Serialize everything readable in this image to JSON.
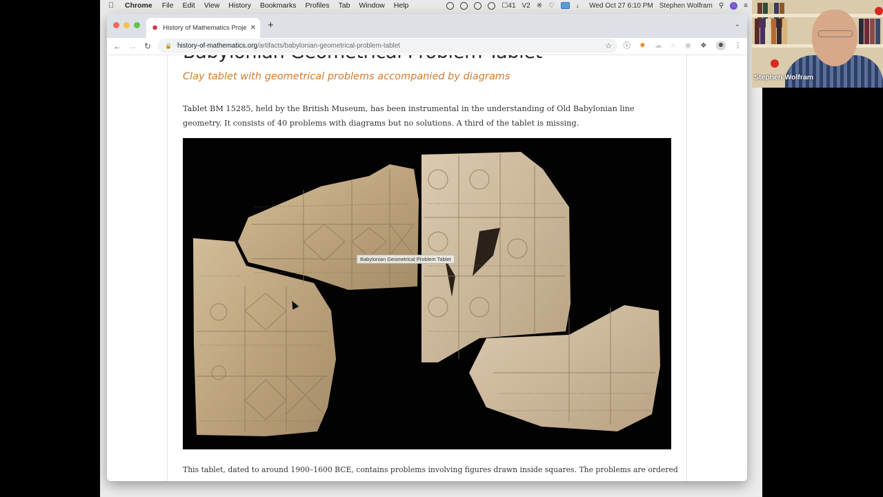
{
  "menubar": {
    "apple_icon": "apple-logo-icon",
    "app_name": "Chrome",
    "items": [
      "File",
      "Edit",
      "View",
      "History",
      "Bookmarks",
      "Profiles",
      "Tab",
      "Window",
      "Help"
    ],
    "status": {
      "battery_badge_count": "41",
      "datetime": "Wed Oct 27  6:10 PM",
      "user": "Stephen Wolfram"
    }
  },
  "browser": {
    "tab": {
      "title": "History of Mathematics Projec",
      "favicon": "gear-favicon-icon",
      "close_glyph": "✕"
    },
    "new_tab_glyph": "+",
    "tab_menu_glyph": "⌄",
    "address": {
      "host": "history-of-mathematics.org",
      "path": "/artifacts/babylonian-geometrical-problem-tablet"
    },
    "nav": {
      "back": "←",
      "forward": "→",
      "reload": "↻"
    }
  },
  "page": {
    "title": "Babylonian Geometrical Problem Tablet",
    "subtitle": "Clay tablet with geometrical problems accompanied by diagrams",
    "intro": "Tablet BM 15285, held by the British Museum, has been instrumental in the understanding of Old Babylonian line geometry. It consists of 40 problems with diagrams but no solutions. A third of the tablet is missing.",
    "image_tooltip": "Babylonian Geometrical Problem Tablet",
    "image_alt": "Photograph of clay tablet fragments with incised geometric diagrams",
    "body": "This tablet, dated to around 1900–1600 BCE, contains problems involving figures drawn inside squares. The problems are ordered by increasing"
  },
  "webcam": {
    "name": "Stephen Wolfram"
  }
}
